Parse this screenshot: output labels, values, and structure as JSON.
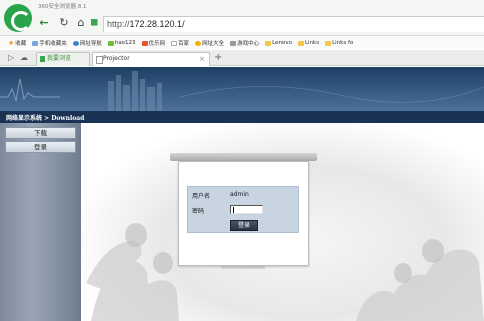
{
  "browser": {
    "app_title": "360安全浏览器 8.1",
    "url_prefix": "http://",
    "url_host": "172.28.120.1/",
    "bookmarks": [
      "收藏",
      "手机收藏夹",
      "网址导航",
      "hao123",
      "优乐网",
      "百家",
      "网址大全",
      "游戏中心",
      "Lenovo",
      "Links",
      "Links fo"
    ],
    "tabs": [
      {
        "label": "我要浏览"
      },
      {
        "label": "Projector"
      }
    ]
  },
  "page": {
    "breadcrumb": "网络显示系统 > Download",
    "sidebar": [
      {
        "label": "下载"
      },
      {
        "label": "登录"
      }
    ],
    "login": {
      "username_label": "用户名",
      "username_value": "admin",
      "password_label": "密码",
      "submit_label": "登录"
    }
  },
  "colors": {
    "banner": "#2d4e75",
    "breadcrumb_bar": "#1a3354",
    "login_panel": "#c8d4e2",
    "login_button": "#333d4c"
  }
}
